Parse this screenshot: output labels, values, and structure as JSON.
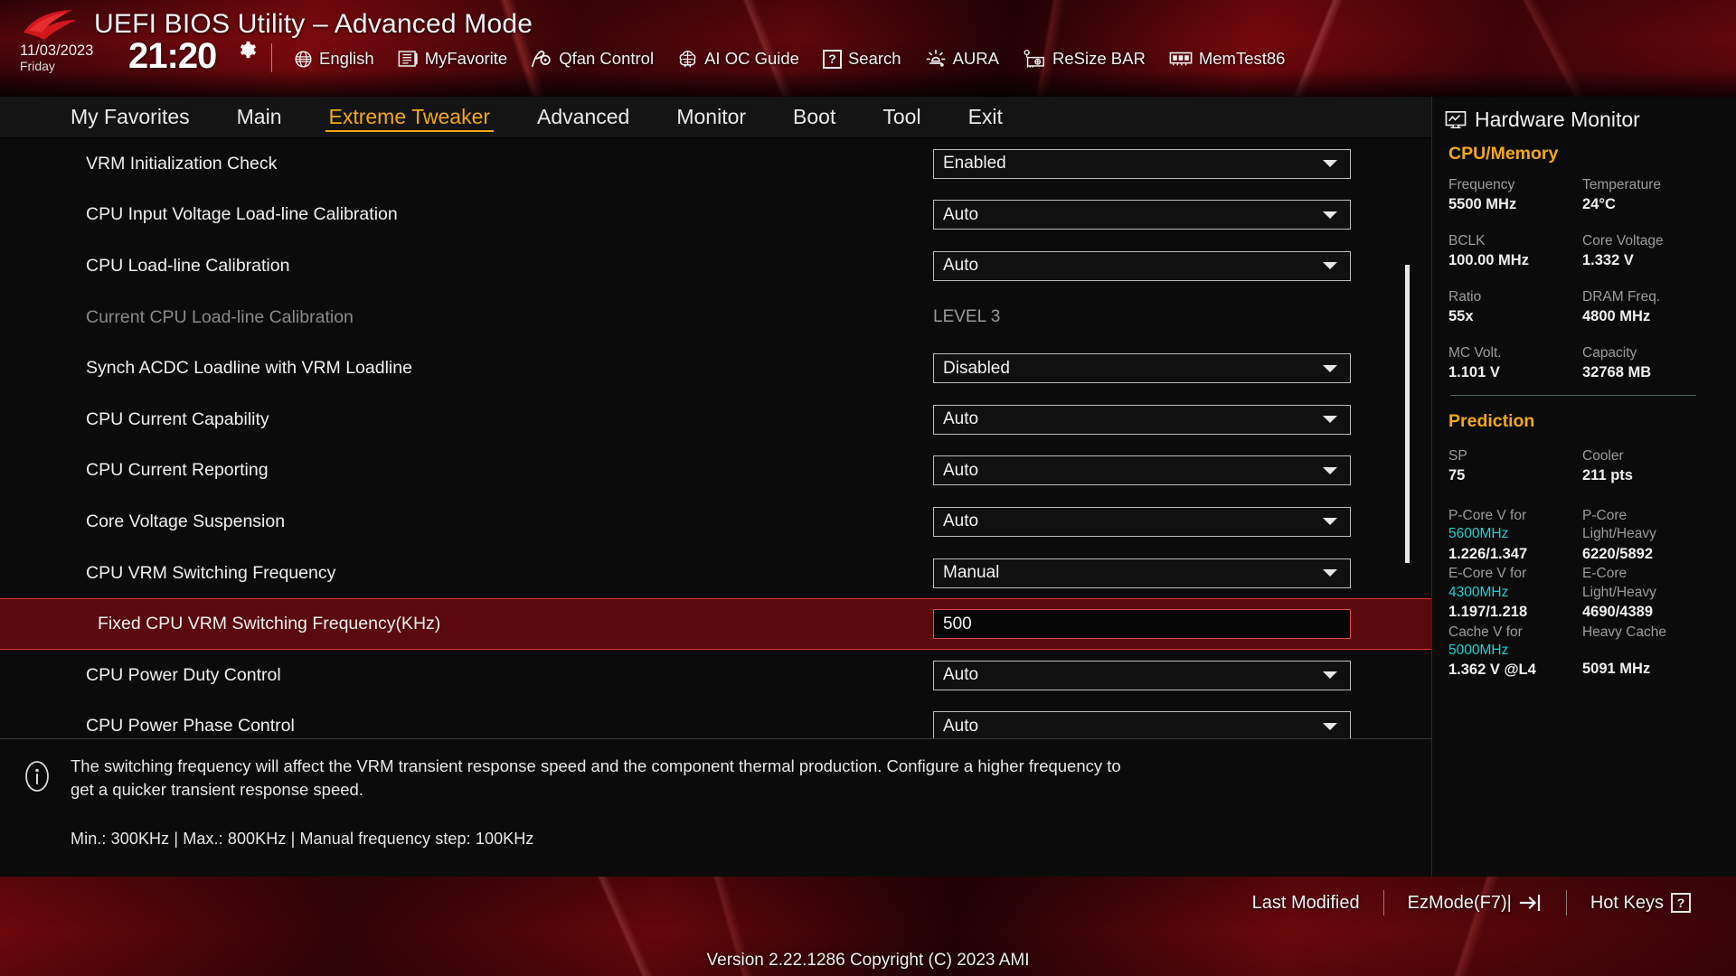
{
  "header": {
    "title": "UEFI BIOS Utility – Advanced Mode",
    "date": "11/03/2023",
    "weekday": "Friday",
    "time": "21:20",
    "gear_icon": "gear-icon",
    "logo_icon": "rog-logo-icon",
    "toolbar": [
      {
        "label": "English",
        "icon": "globe-icon"
      },
      {
        "label": "MyFavorite",
        "icon": "favorites-icon"
      },
      {
        "label": "Qfan Control",
        "icon": "fan-icon"
      },
      {
        "label": "AI OC Guide",
        "icon": "brain-icon"
      },
      {
        "label": "Search",
        "icon": "question-box-icon"
      },
      {
        "label": "AURA",
        "icon": "aura-light-icon"
      },
      {
        "label": "ReSize BAR",
        "icon": "gpu-card-icon"
      },
      {
        "label": "MemTest86",
        "icon": "memory-module-icon"
      }
    ]
  },
  "nav": {
    "tabs": [
      {
        "label": "My Favorites",
        "active": false
      },
      {
        "label": "Main",
        "active": false
      },
      {
        "label": "Extreme Tweaker",
        "active": true
      },
      {
        "label": "Advanced",
        "active": false
      },
      {
        "label": "Monitor",
        "active": false
      },
      {
        "label": "Boot",
        "active": false
      },
      {
        "label": "Tool",
        "active": false
      },
      {
        "label": "Exit",
        "active": false
      }
    ]
  },
  "settings": [
    {
      "label": "VRM Initialization Check",
      "value": "Enabled",
      "type": "select"
    },
    {
      "label": "CPU Input Voltage Load-line Calibration",
      "value": "Auto",
      "type": "select"
    },
    {
      "label": "CPU Load-line Calibration",
      "value": "Auto",
      "type": "select"
    },
    {
      "label": "Current CPU Load-line Calibration",
      "value": "LEVEL 3",
      "type": "readonly"
    },
    {
      "label": "Synch ACDC Loadline with VRM Loadline",
      "value": "Disabled",
      "type": "select"
    },
    {
      "label": "CPU Current Capability",
      "value": "Auto",
      "type": "select"
    },
    {
      "label": "CPU Current Reporting",
      "value": "Auto",
      "type": "select"
    },
    {
      "label": "Core Voltage Suspension",
      "value": "Auto",
      "type": "select"
    },
    {
      "label": "CPU VRM Switching Frequency",
      "value": "Manual",
      "type": "select"
    },
    {
      "label": "Fixed CPU VRM Switching Frequency(KHz)",
      "value": "500",
      "type": "input",
      "highlighted": true,
      "indent": true
    },
    {
      "label": "CPU Power Duty Control",
      "value": "Auto",
      "type": "select"
    },
    {
      "label": "CPU Power Phase Control",
      "value": "Auto",
      "type": "select"
    }
  ],
  "help": {
    "icon": "info-icon",
    "text": "The switching frequency will affect the VRM transient response speed and the component thermal production. Configure a higher frequency to get a quicker transient response speed.",
    "limits": "Min.: 300KHz   |   Max.: 800KHz   |   Manual frequency step: 100KHz"
  },
  "hardware_monitor": {
    "title": "Hardware Monitor",
    "icon": "monitor-chart-icon",
    "sections": [
      {
        "name": "CPU/Memory",
        "pairs": [
          {
            "k1": "Frequency",
            "v1": "5500 MHz",
            "k2": "Temperature",
            "v2": "24°C"
          },
          {
            "k1": "BCLK",
            "v1": "100.00 MHz",
            "k2": "Core Voltage",
            "v2": "1.332 V"
          },
          {
            "k1": "Ratio",
            "v1": "55x",
            "k2": "DRAM Freq.",
            "v2": "4800 MHz"
          },
          {
            "k1": "MC Volt.",
            "v1": "1.101 V",
            "k2": "Capacity",
            "v2": "32768 MB"
          }
        ]
      },
      {
        "name": "Prediction",
        "pairs": [
          {
            "k1": "SP",
            "v1": "75",
            "k2": "Cooler",
            "v2": "211 pts"
          }
        ],
        "stacked": [
          {
            "k1a": "P-Core V for",
            "k1b": "5600MHz",
            "v1": "1.226/1.347",
            "k2a": "P-Core",
            "k2b": "Light/Heavy",
            "v2": "6220/5892"
          },
          {
            "k1a": "E-Core V for",
            "k1b": "4300MHz",
            "v1": "1.197/1.218",
            "k2a": "E-Core",
            "k2b": "Light/Heavy",
            "v2": "4690/4389"
          },
          {
            "k1a": "Cache V for",
            "k1b": "5000MHz",
            "v1": "1.362 V @L4",
            "k2a": "Heavy Cache",
            "k2b": "",
            "v2": "5091 MHz"
          }
        ]
      }
    ]
  },
  "footer": {
    "items": [
      {
        "label": "Last Modified",
        "icon": ""
      },
      {
        "label": "EzMode(F7)|",
        "icon": "exit-arrow-icon"
      },
      {
        "label": "Hot Keys",
        "icon": "question-box-icon"
      }
    ],
    "version": "Version 2.22.1286 Copyright (C) 2023 AMI"
  },
  "colors": {
    "accent_gold": "#f0a818",
    "accent_cyan": "#22cfcf",
    "highlight_row": "#5a0a0e",
    "panel_bg": "#0b0b0b"
  }
}
